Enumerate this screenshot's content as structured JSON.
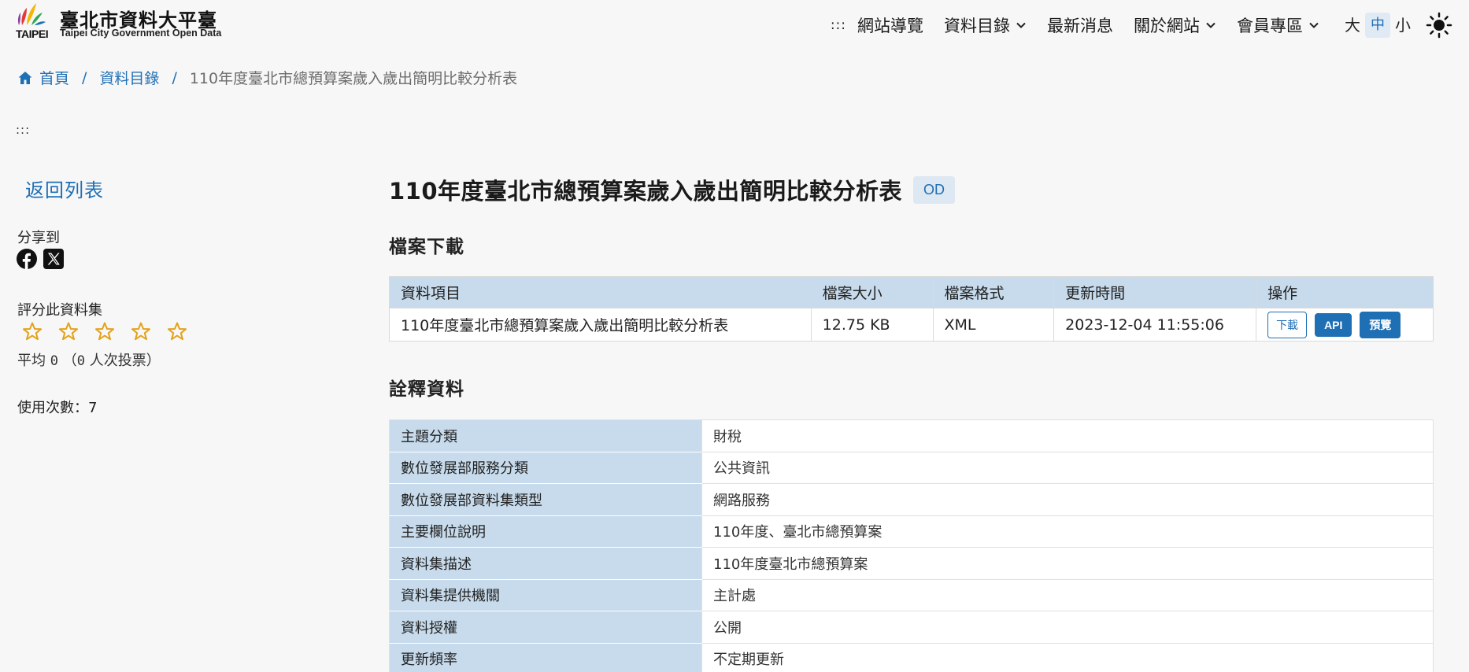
{
  "header": {
    "logo_cn": "臺北市資料大平臺",
    "logo_en": "Taipei City Government Open Data",
    "logo_taipei": "TAIPEI",
    "nav_dots": ":::",
    "nav": [
      {
        "label": "網站導覽",
        "dropdown": false
      },
      {
        "label": "資料目錄",
        "dropdown": true
      },
      {
        "label": "最新消息",
        "dropdown": false
      },
      {
        "label": "關於網站",
        "dropdown": true
      },
      {
        "label": "會員專區",
        "dropdown": true
      }
    ],
    "font_sizes": [
      "大",
      "中",
      "小"
    ],
    "font_size_active": "中",
    "theme_icon": "sun-icon"
  },
  "breadcrumb": {
    "home": "首頁",
    "sep": "/",
    "catalog": "資料目錄",
    "current": "110年度臺北市總預算案歲入歲出簡明比較分析表"
  },
  "skip_dots": ":::",
  "sidebar": {
    "back": "返回列表",
    "share_label": "分享到",
    "rate_label": "評分此資料集",
    "avg_prefix": "平均",
    "avg_value": "0",
    "avg_open": "（",
    "votes": "0",
    "votes_suffix": "人次投票）",
    "usage": "使用次數：7"
  },
  "main": {
    "title": "110年度臺北市總預算案歲入歲出簡明比較分析表",
    "badge": "OD",
    "download_heading": "檔案下載",
    "download_table": {
      "headers": [
        "資料項目",
        "檔案大小",
        "檔案格式",
        "更新時間",
        "操作"
      ],
      "row": {
        "item": "110年度臺北市總預算案歲入歲出簡明比較分析表",
        "size": "12.75 KB",
        "format": "XML",
        "updated": "2023-12-04 11:55:06",
        "btn_download": "下載",
        "btn_api": "API",
        "btn_preview": "預覽"
      }
    },
    "meta_heading": "詮釋資料",
    "meta_rows": [
      {
        "k": "主題分類",
        "v": "財稅"
      },
      {
        "k": "數位發展部服務分類",
        "v": "公共資訊"
      },
      {
        "k": "數位發展部資料集類型",
        "v": "網路服務"
      },
      {
        "k": "主要欄位說明",
        "v": "110年度、臺北市總預算案"
      },
      {
        "k": "資料集描述",
        "v": "110年度臺北市總預算案"
      },
      {
        "k": "資料集提供機關",
        "v": "主計處"
      },
      {
        "k": "資料授權",
        "v": "公開"
      },
      {
        "k": "更新頻率",
        "v": "不定期更新"
      }
    ]
  },
  "colors": {
    "accent": "#1f6fb5",
    "header_cell": "#c7dbec",
    "star": "#e3a21a",
    "background": "#f7f7f7"
  }
}
